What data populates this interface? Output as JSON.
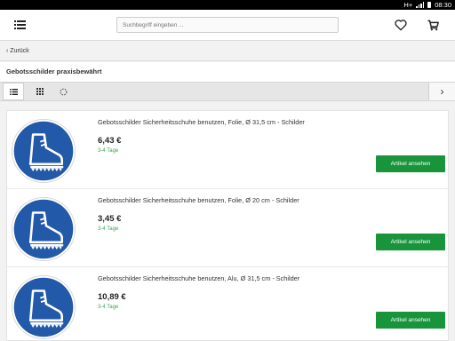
{
  "statusbar": {
    "network": "H+",
    "time": "08:30"
  },
  "header": {
    "search_placeholder": "Suchbegriff eingeben ..."
  },
  "nav": {
    "back_label": "Zurück"
  },
  "page": {
    "title": "Gebotsschilder praxisbewährt"
  },
  "toolbar": {
    "active_view": "list"
  },
  "products": [
    {
      "name": "Gebotsschilder Sicherheitsschuhe benutzen, Folie, Ø 31,5 cm - Schilder",
      "price": "6,43 €",
      "delivery": "3-4 Tage",
      "button": "Artikel ansehen"
    },
    {
      "name": "Gebotsschilder Sicherheitsschuhe benutzen, Folie, Ø 20 cm - Schilder",
      "price": "3,45 €",
      "delivery": "3-4 Tage",
      "button": "Artikel ansehen"
    },
    {
      "name": "Gebotsschilder Sicherheitsschuhe benutzen, Alu, Ø 31,5 cm - Schilder",
      "price": "10,89 €",
      "delivery": "3-4 Tage",
      "button": "Artikel ansehen"
    }
  ],
  "colors": {
    "accent": "#18943a",
    "sign_blue": "#2259a8",
    "delivery": "#3aa55a"
  }
}
